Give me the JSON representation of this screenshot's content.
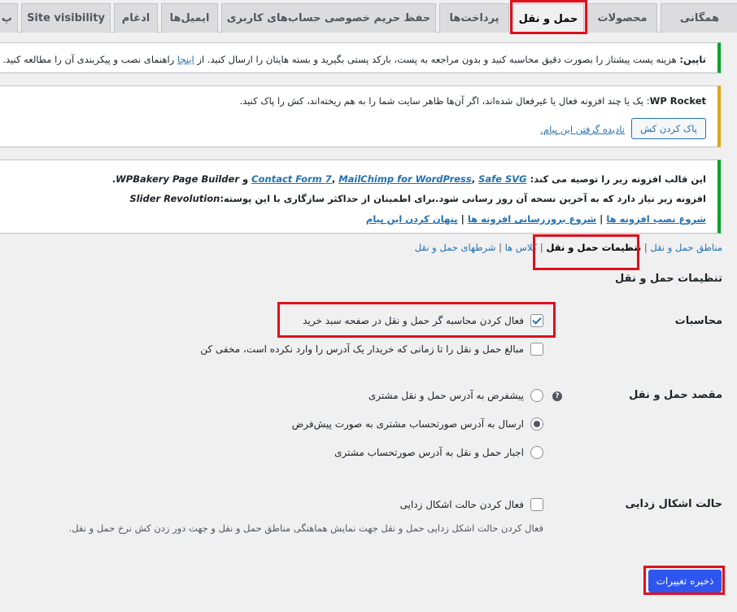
{
  "tabs": [
    {
      "label": "همگانی"
    },
    {
      "label": "محصولات"
    },
    {
      "label": "حمل و نقل"
    },
    {
      "label": "پرداخت‌ها"
    },
    {
      "label": "حفظ حریم خصوصی حساب‌های کاربری"
    },
    {
      "label": "ایمیل‌ها"
    },
    {
      "label": "ادغام"
    },
    {
      "label": "Site visibility"
    },
    {
      "label": "پ"
    }
  ],
  "notice_tapin": {
    "brand": "تاپین:",
    "text_before": " هزینه پست پیشتاز را بصورت دقیق محاسبه کنید و بدون مراجعه به پست، بارکد پستی بگیرید و بسته هایتان را ارسال کنید. از ",
    "link": "اینجا",
    "text_after": " راهنمای نصب و پیکربندی آن را مطالعه کنید."
  },
  "notice_rocket": {
    "brand": "WP Rocket",
    "text": ": یک یا چند افزونه فعال یا غیرفعال شده‌اند، اگر آن‌ها ظاهر سایت شما را به هم ریخته‌اند، کش را پاک کنید.",
    "clear_button": "پاک کردن کش",
    "dismiss_link": "نادیده گرفتن این پیام."
  },
  "notice_plugins": {
    "line1_prefix": "این قالب افزونه زیر را توصیه می کند: ",
    "plugins": [
      "Contact Form 7",
      "MailChimp for WordPress",
      "Safe SVG"
    ],
    "sep": ", ",
    "and_word": " و ",
    "last_plugin": "WPBakery Page Builder",
    "line1_suffix": ".",
    "line2": "افزونه زیر نیاز دارد که به آخرین نسخه آن روز رسانی شود.برای اطمینان از حداکثر سازگاری با این پوسته:",
    "line2_plugin": "Slider Revolution",
    "link_install": "شروع نصب افزونه ها",
    "link_update": "شروع بروزرسانی افزونه ها",
    "link_hide": "پنهان کردن این پیام",
    "divider": " | "
  },
  "subnav": {
    "zones": "مناطق حمل و نقل",
    "settings": "تنظیمات حمل و نقل",
    "classes": "کلاس ها",
    "conditions": "شرطهای حمل و نقل",
    "divider": " | "
  },
  "form": {
    "heading": "تنظیمات حمل و نقل",
    "calc_label": "محاسبات",
    "calc_opt1": "فعال کردن محاسبه گر حمل و نقل در صفحه سبد خرید",
    "calc_opt2": "مبالغ حمل و نقل را تا زمانی که خریدار یک آدرس را وارد نکرده است، مخفی کن",
    "dest_label": "مقصد حمل و نقل",
    "help_icon": "?",
    "dest_opt1": "پیشفرض به آدرس حمل و نقل مشتری",
    "dest_opt2": "ارسال به آدرس صورتحساب مشتری به صورت پیش‌فرض",
    "dest_opt3": "اجبار حمل و نقل به آدرس صورتحساب مشتری",
    "debug_label": "حالت اشکال زدایی",
    "debug_opt": "فعال کردن حالت اشکال زدایی",
    "debug_desc": "فعال کردن حالت اشکل زدایی حمل و نقل جهت نمایش هماهنگی مناطق حمل و نقل و جهت دور زدن کش نرخ حمل و نقل.",
    "save": "ذخیره تغییرات"
  },
  "colors": {
    "highlight": "#e0101c",
    "primary": "#2f55f0",
    "link": "#2271b1",
    "notice_green": "#00a32a",
    "notice_yellow": "#dba617"
  }
}
